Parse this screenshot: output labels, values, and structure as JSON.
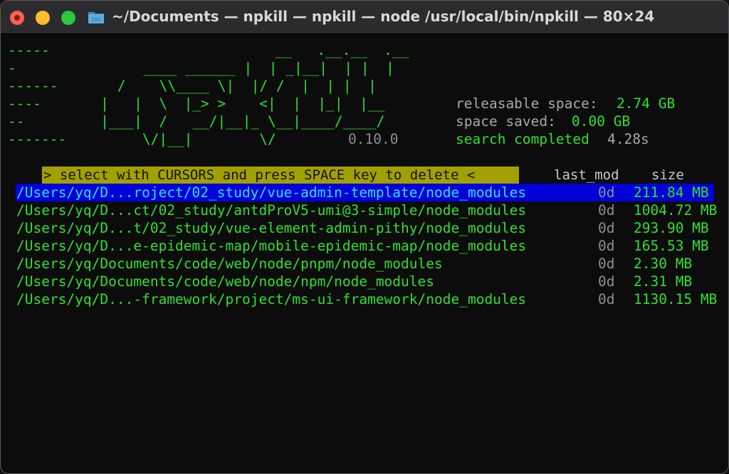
{
  "window": {
    "title": "~/Documents — npkill — npkill — node /usr/local/bin/npkill — 80×24"
  },
  "logo": {
    "dash_lines": [
      "-----",
      "-",
      "------",
      "----",
      "--",
      "-------"
    ],
    "art_lines": [
      "                                __   .__.__  .__",
      "         ____ ______ |  | _|__|  | |  |",
      "        /    \\\\____ \\|  |/ /  |  | |  |",
      "       |   |  \\  |_> >    <|  |  |_|  |__",
      "       |___|  /   __/|__|_ \\__|____/____/",
      "            \\/|__|        \\/"
    ],
    "version": "0.10.0"
  },
  "stats": {
    "releasable_label": "releasable space: ",
    "releasable_value": "2.74 GB",
    "saved_label": "space saved: ",
    "saved_value": "0.00 GB",
    "search_label": "search completed ",
    "search_time": "4.28s"
  },
  "banner": {
    "text": "> select with CURSORS and press SPACE key to delete <"
  },
  "columns": {
    "last_mod": "last_mod",
    "size": "size"
  },
  "results": [
    {
      "path": "/Users/yq/D...roject/02_study/vue-admin-template/node_modules",
      "mod": "0d",
      "size": "211.84 MB"
    },
    {
      "path": "/Users/yq/D...ct/02_study/antdProV5-umi@3-simple/node_modules",
      "mod": "0d",
      "size": "1004.72 MB"
    },
    {
      "path": "/Users/yq/D...t/02_study/vue-element-admin-pithy/node_modules",
      "mod": "0d",
      "size": "293.90 MB"
    },
    {
      "path": "/Users/yq/D...e-epidemic-map/mobile-epidemic-map/node_modules",
      "mod": "0d",
      "size": "165.53 MB"
    },
    {
      "path": "/Users/yq/Documents/code/web/node/pnpm/node_modules",
      "mod": "0d",
      "size": "2.30 MB"
    },
    {
      "path": "/Users/yq/Documents/code/web/node/npm/node_modules",
      "mod": "0d",
      "size": "2.31 MB"
    },
    {
      "path": "/Users/yq/D...-framework/project/ms-ui-framework/node_modules",
      "mod": "0d",
      "size": "1130.15 MB"
    }
  ],
  "colors": {
    "accent_green": "#2fe02f",
    "selection_bg": "#0000d8",
    "banner_bg": "#a2a000"
  }
}
